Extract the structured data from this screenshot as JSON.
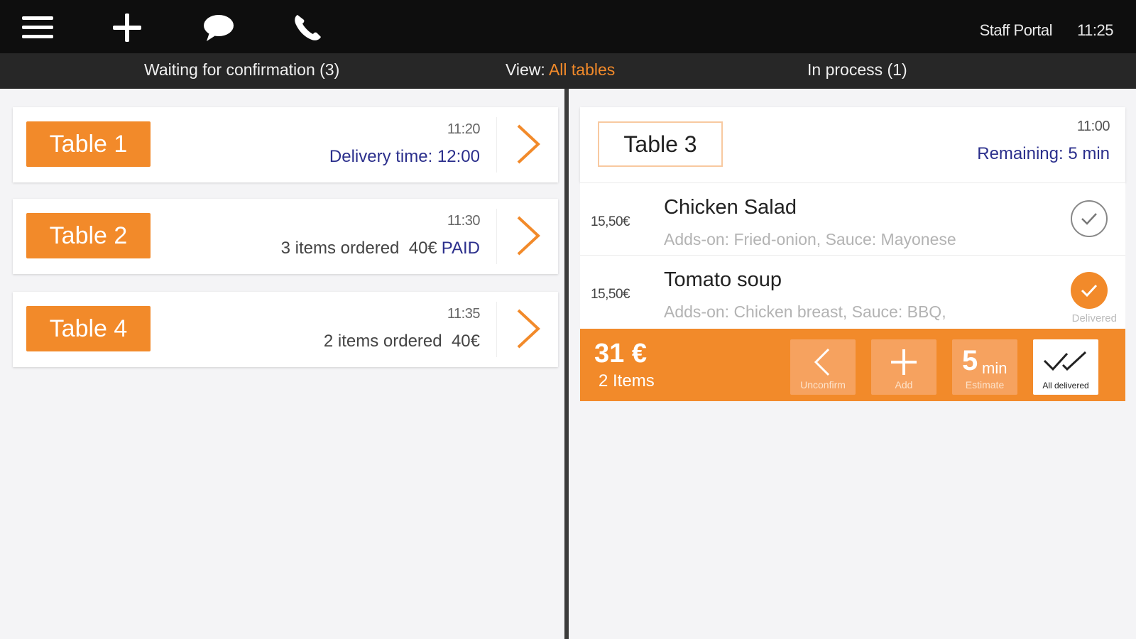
{
  "topbar": {
    "icons": [
      "menu-icon",
      "plus-icon",
      "chat-icon",
      "phone-icon"
    ],
    "portal_label": "Staff Portal",
    "time": "11:25"
  },
  "subbar": {
    "waiting_label": "Waiting for confirmation (3)",
    "view_label": "View: ",
    "view_value": "All tables",
    "in_process_label": "In process (1)"
  },
  "waiting_tables": [
    {
      "label": "Table 1",
      "time": "11:20",
      "info": "Delivery time: 12:00",
      "paid": ""
    },
    {
      "label": "Table 2",
      "time": "11:30",
      "info": "3 items ordered  40€",
      "paid": "PAID"
    },
    {
      "label": "Table 4",
      "time": "11:35",
      "info": "2 items ordered  40€",
      "paid": ""
    }
  ],
  "order": {
    "table_label": "Table 3",
    "time": "11:00",
    "remaining": "Remaining: 5 min",
    "items": [
      {
        "price": "15,50€",
        "name": "Chicken Salad",
        "adds": "Adds-on: Fried-onion, Sauce: Mayonese",
        "delivered": false,
        "status_label": ""
      },
      {
        "price": "15,50€",
        "name": "Tomato soup",
        "adds": "Adds-on: Chicken breast, Sauce: BBQ,",
        "delivered": true,
        "status_label": "Delivered"
      }
    ],
    "total": "31 €",
    "items_count": "2 Items",
    "actions": {
      "unconfirm": "Unconfirm",
      "add": "Add",
      "estimate_value": "5",
      "estimate_unit": "min",
      "estimate": "Estimate",
      "all_delivered": "All delivered"
    }
  },
  "colors": {
    "accent": "#f28a2a",
    "link_blue": "#2b2f8c",
    "topbar": "#0e0e0e",
    "subbar": "#272727"
  }
}
